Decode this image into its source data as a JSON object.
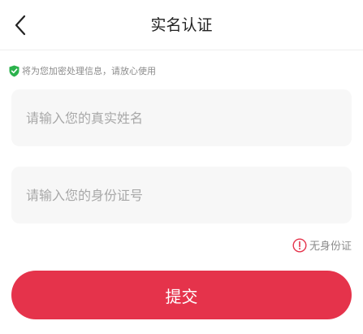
{
  "header": {
    "title": "实名认证",
    "back_icon": "chevron-left-icon"
  },
  "notice": {
    "icon": "shield-check-icon",
    "icon_color": "#2bb24c",
    "text": "将为您加密处理信息，请放心使用"
  },
  "form": {
    "name_placeholder": "请输入您的真实姓名",
    "name_value": "",
    "id_placeholder": "请输入您的身份证号",
    "id_value": ""
  },
  "no_id_link": {
    "icon": "exclamation-circle-icon",
    "icon_color": "#e5334b",
    "label": "无身份证"
  },
  "submit": {
    "label": "提交",
    "color": "#e5334b"
  }
}
